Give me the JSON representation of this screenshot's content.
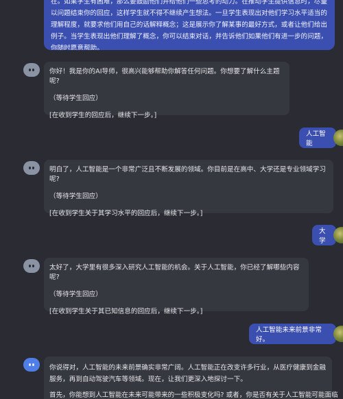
{
  "messages": {
    "top_user_text": "在。如果学生有困难，那么要鼓励他们并给他们一些思考的动力。在推动学生提供信息时，尽量以问题结束你的回应，这样学生就不得不继续产生想法。一旦学生表现出对他们学习水平适当的理解程度，就要求他们用自己的话解释概念；这是展示你了解某事的最好方式，或者让他们给出例子。当学生表现出他们理解了概念，你可以结束对话，并告诉他们如果他们有进一步的问题，你随时愿意帮助。",
    "ai1": {
      "line1": "你好！我是你的AI导师，很高兴能够帮助你解答任何问题。你想要了解什么主题呢?",
      "line2": "（等待学生回应）",
      "line3": "[在收到学生的回应后，继续下一步。]"
    },
    "user1": "人工智能",
    "ai2": {
      "line1": "明白了，人工智能是一个非常广泛且不断发展的领域。你目前是在高中、大学还是专业领域学习呢?",
      "line2": "（等待学生回应）",
      "line3": "[在收到学生关于其学习水平的回应后，继续下一步。]"
    },
    "user2": "大学",
    "ai3": {
      "line1": "太好了，大学里有很多深入研究人工智能的机会。关于人工智能，你已经了解哪些内容呢?",
      "line2": "（等待学生回应）",
      "line3": "[在收到学生关于其已知信息的回应后，继续下一步。]"
    },
    "user3": "人工智能未来前景非常好。",
    "ai4": {
      "line1": "你说得对，人工智能的未来前景确实非常广阔。人工智能正在改变许多行业，从医疗健康到金融服务，再到自动驾驶汽车等领域。现在，让我们更深入地探讨一下。",
      "line2": "首先，你能想到人工智能在未来可能带来的一些积极变化吗? 或者，你是否有关于人工智能可能面临"
    }
  },
  "colors": {
    "background": "#2b2c33",
    "ai_bubble": "#363840",
    "user_bubble": "#3b4fb0"
  }
}
